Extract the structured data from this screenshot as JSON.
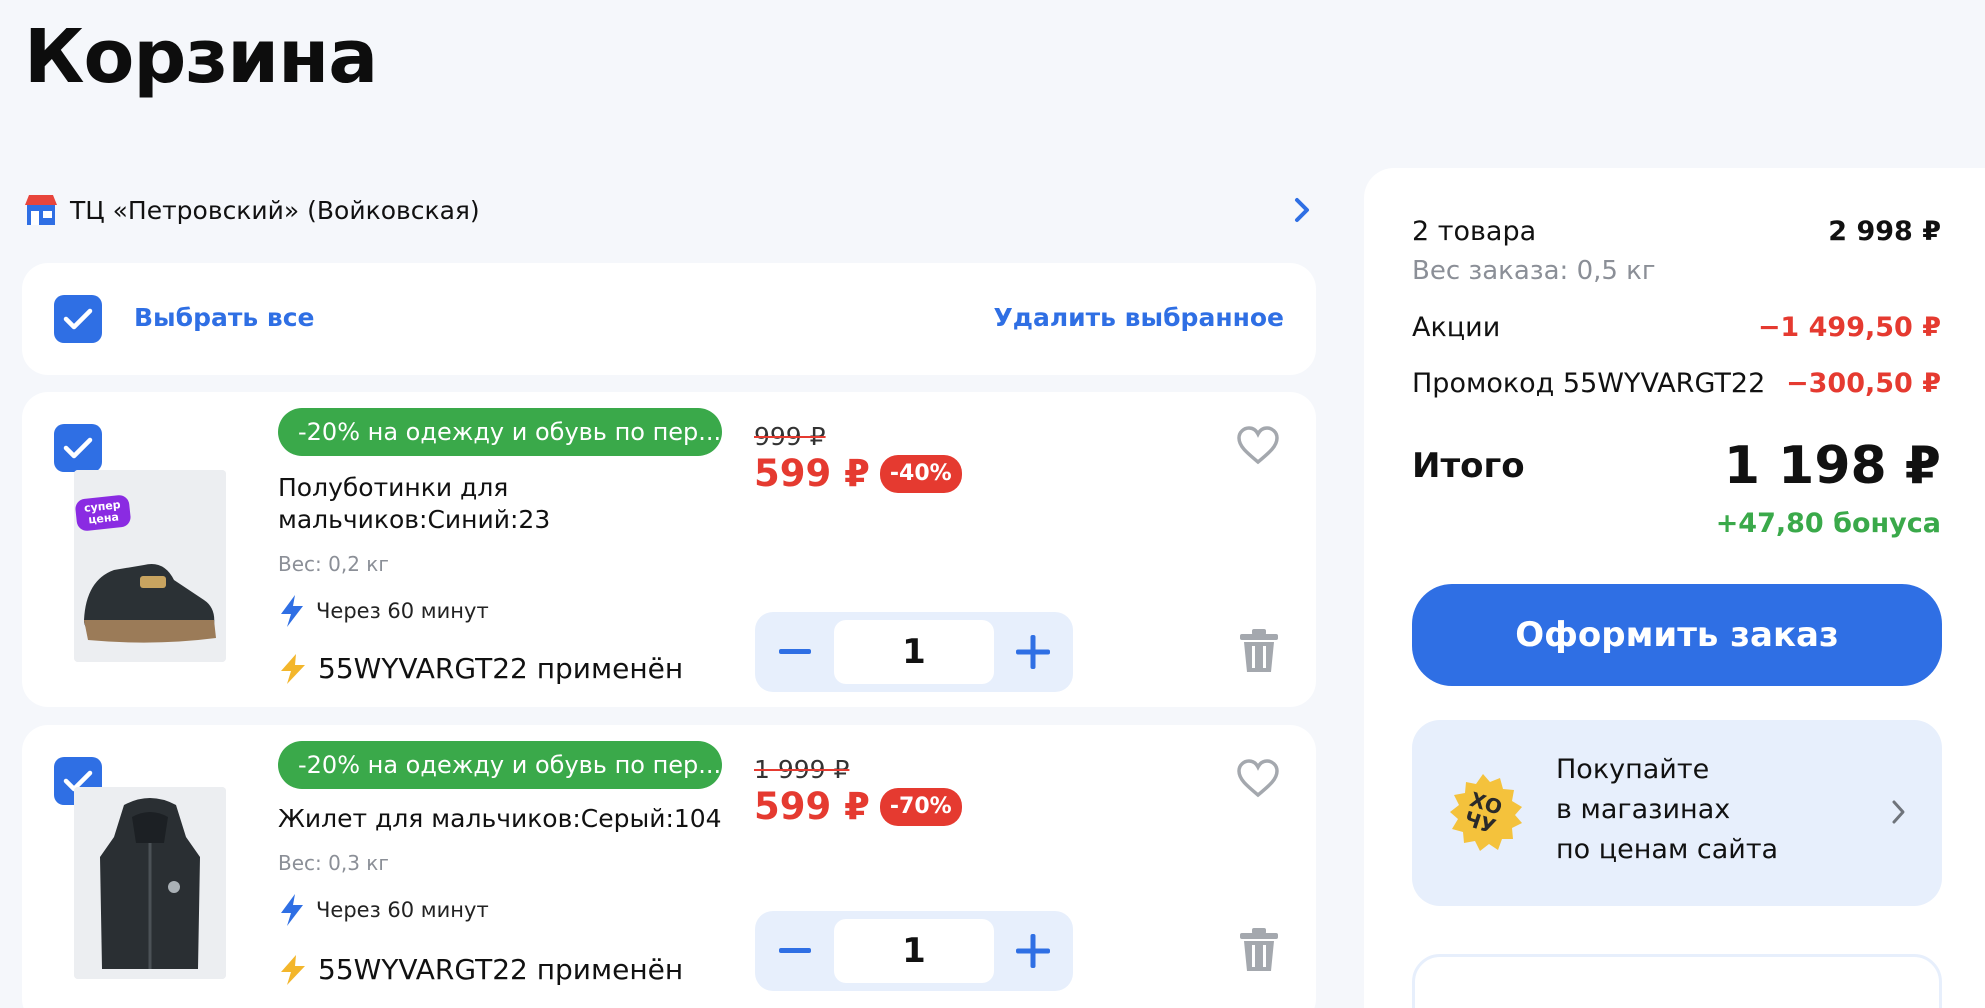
{
  "page": {
    "title": "Корзина"
  },
  "store": {
    "name": "ТЦ «Петровский» (Войковская)"
  },
  "selection": {
    "select_all": "Выбрать все",
    "delete_selected": "Удалить выбранное"
  },
  "items": [
    {
      "promo": "-20% на одежду и обувь по пер...",
      "title_line1": "Полуботинки для",
      "title_line2": "мальчиков:Синий:23",
      "badge": "супер цена",
      "weight": "Вес: 0,2 кг",
      "delivery": "Через 60 минут",
      "promo_applied": "55WYVARGT22 применён",
      "old_price": "999 ₽",
      "price": "599 ₽",
      "discount": "-40%",
      "quantity": "1"
    },
    {
      "promo": "-20% на одежду и обувь по пер...",
      "title_line1": "Жилет для мальчиков:Серый:104",
      "weight": "Вес: 0,3 кг",
      "delivery": "Через 60 минут",
      "promo_applied": "55WYVARGT22 применён",
      "old_price": "1 999 ₽",
      "price": "599 ₽",
      "discount": "-70%",
      "quantity": "1"
    }
  ],
  "summary": {
    "items_label": "2 товара",
    "items_total": "2 998 ₽",
    "weight": "Вес заказа: 0,5 кг",
    "promos_label": "Акции",
    "promos_value": "−1 499,50 ₽",
    "promocode_label": "Промокод 55WYVARGT22",
    "promocode_value": "−300,50 ₽",
    "total_label": "Итого",
    "total_value": "1 198 ₽",
    "bonus": "+47,80 бонуса",
    "checkout": "Оформить заказ",
    "store_promo_line1": "Покупайте",
    "store_promo_line2": "в магазинах",
    "store_promo_line3": "по ценам сайта",
    "store_promo_logo": "ХОЧУ"
  },
  "colors": {
    "accent": "#2f6fe4",
    "red": "#e53a30",
    "green": "#3aa94a",
    "bg": "#f5f7fb"
  }
}
